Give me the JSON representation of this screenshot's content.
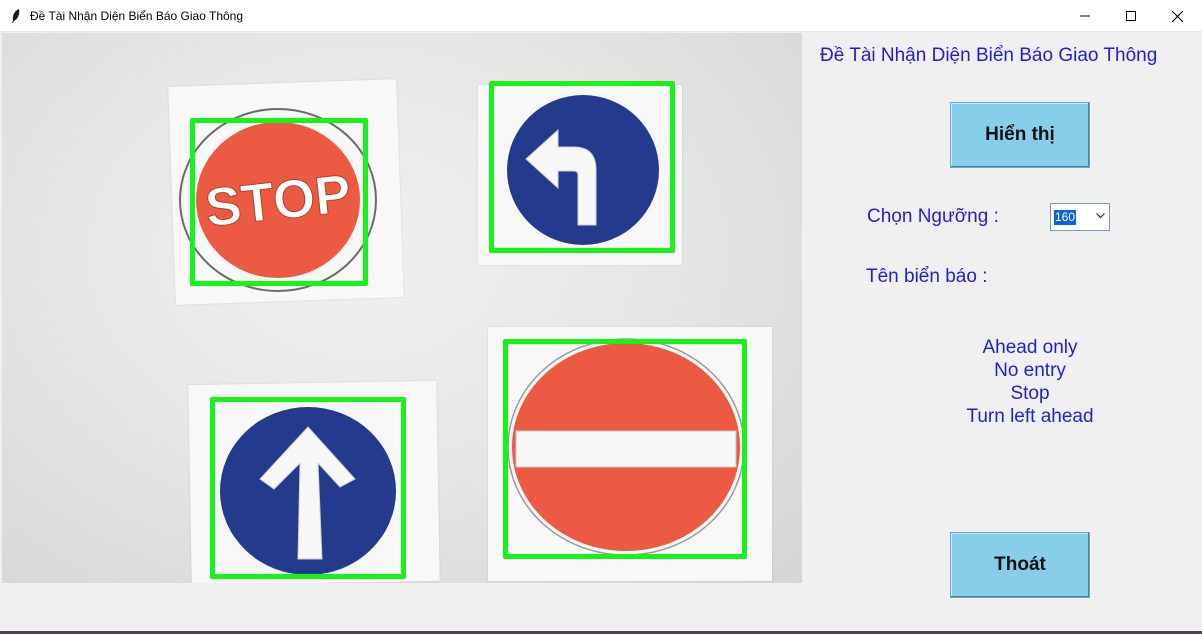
{
  "window": {
    "title": "Đề Tài Nhận Diện Biển Báo Giao Thông",
    "controls": [
      "minimize-icon",
      "maximize-icon",
      "close-icon"
    ]
  },
  "camera": {
    "detections": [
      {
        "sign": "stop",
        "text": "STOP",
        "icon": "stop-sign",
        "box_color": "#17f21b"
      },
      {
        "sign": "turn-left-ahead",
        "icon": "turn-left-arrow",
        "box_color": "#17f21b"
      },
      {
        "sign": "ahead-only",
        "icon": "up-arrow",
        "box_color": "#17f21b"
      },
      {
        "sign": "no-entry",
        "icon": "no-entry-bar",
        "box_color": "#17f21b"
      }
    ]
  },
  "panel": {
    "heading": "Đề Tài Nhận Diện Biển Báo Giao Thông",
    "show_button": "Hiển thị",
    "threshold_label": "Chọn Ngưỡng :",
    "threshold_value": "160",
    "sign_name_label": "Tên biển báo :",
    "results": [
      "Ahead only",
      "No entry",
      "Stop",
      "Turn left ahead"
    ],
    "exit_button": "Thoát"
  },
  "colors": {
    "text_blue": "#1f1fd6",
    "button_bg": "#87ceeb",
    "box_green": "#17f21b",
    "sign_red": "#ec5a43",
    "sign_blue": "#243a8c"
  }
}
